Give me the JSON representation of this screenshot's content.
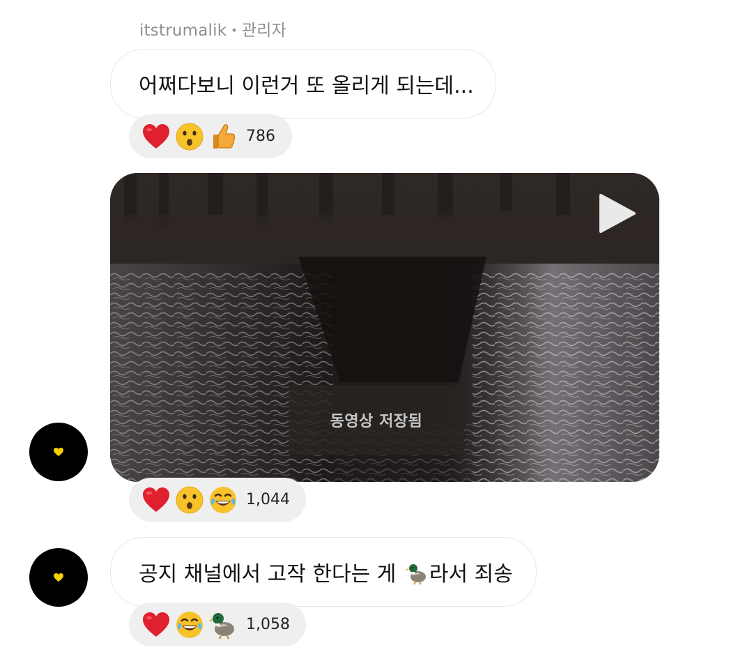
{
  "header": {
    "username": "itstrumalik",
    "separator": "•",
    "role": "관리자"
  },
  "messages": [
    {
      "text": "어쩌다보니 이런거 또 올리게 되는데...",
      "reactions": [
        "heart",
        "astonished-face",
        "thumbs-up"
      ],
      "reaction_count": "786"
    },
    {
      "video": {
        "status_label": "동영상 저장됨"
      },
      "reactions": [
        "heart",
        "astonished-face",
        "tears-of-joy-face"
      ],
      "reaction_count": "1,044"
    },
    {
      "text_before": "공지 채널에서 고작 한다는 게 ",
      "inline_emoji": "duck",
      "text_after": "라서 죄송",
      "reactions": [
        "heart",
        "tears-of-joy-face",
        "duck"
      ],
      "reaction_count": "1,058"
    }
  ],
  "avatar": {
    "icon": "yellow-heart-icon"
  },
  "colors": {
    "bubble_border": "#e7e7e7",
    "reaction_bg": "#efefef",
    "avatar_bg": "#000000",
    "heart": "#e0202e",
    "emoji_yellow": "#f7c22a"
  }
}
